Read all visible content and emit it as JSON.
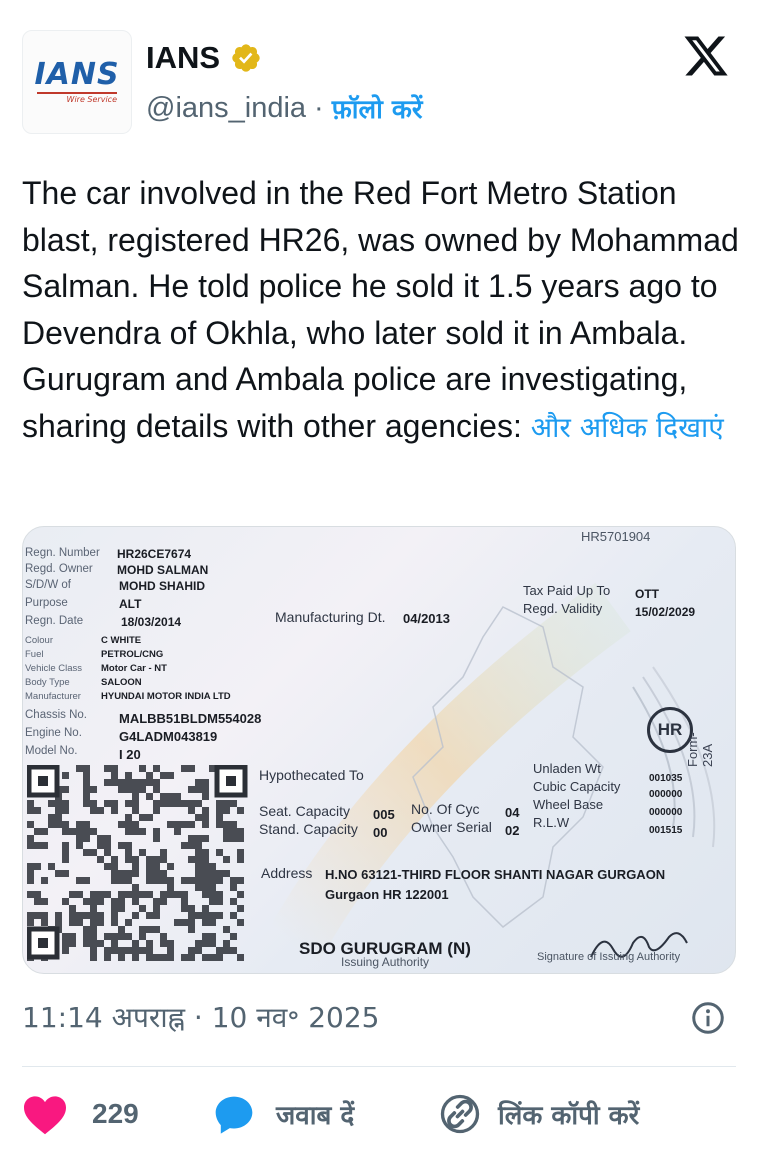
{
  "account": {
    "avatar_text": "IANS",
    "avatar_sub": "Wire Service",
    "display_name": "IANS",
    "handle": "@ians_india",
    "separator": "·",
    "follow_label": "फ़ॉलो करें"
  },
  "tweet": {
    "text": "The car involved in the Red Fort Metro Station blast, registered HR26, was owned by Mohammad Salman. He told police he sold it 1.5 years ago to Devendra of Okhla, who later sold it in Ambala. Gurugram and Ambala police are investigating, sharing details with other agencies: ",
    "show_more": "और अधिक दिखाएं"
  },
  "rc_card": {
    "top_code": "HR5701904",
    "fields": [
      {
        "label": "Regn. Number",
        "value": "HR26CE7674"
      },
      {
        "label": "Regd. Owner",
        "value": "MOHD SALMAN"
      },
      {
        "label": "S/D/W of",
        "value": "MOHD SHAHID"
      },
      {
        "label": "Purpose",
        "value": "ALT"
      },
      {
        "label": "Regn. Date",
        "value": "18/03/2014"
      },
      {
        "label": "Colour",
        "value": "C WHITE"
      },
      {
        "label": "Fuel",
        "value": "PETROL/CNG"
      },
      {
        "label": "Vehicle Class",
        "value": "Motor Car - NT"
      },
      {
        "label": "Body Type",
        "value": "SALOON"
      },
      {
        "label": "Manufacturer",
        "value": "HYUNDAI MOTOR INDIA LTD"
      },
      {
        "label": "Chassis No.",
        "value": "MALBB51BLDM554028"
      },
      {
        "label": "Engine No.",
        "value": "G4LADM043819"
      },
      {
        "label": "Model No.",
        "value": "I 20"
      }
    ],
    "mfg_label": "Manufacturing Dt.",
    "mfg_value": "04/2013",
    "tax_label": "Tax Paid Up To",
    "tax_value": "OTT",
    "validity_label": "Regd. Validity",
    "validity_value": "15/02/2029",
    "state_badge": "HR",
    "form_label": "Form-23A",
    "hypothecated_label": "Hypothecated To",
    "unladen_label": "Unladen Wt",
    "unladen_value": "001035",
    "cubic_label": "Cubic Capacity",
    "cubic_value": "000000",
    "wheelbase_label": "Wheel Base",
    "wheelbase_value": "000000",
    "rlw_label": "R.L.W",
    "rlw_value": "001515",
    "seat_label": "Seat. Capacity",
    "seat_value": "005",
    "stand_label": "Stand. Capacity",
    "stand_value": "00",
    "cyc_label": "No. Of Cyc",
    "cyc_value": "04",
    "owner_serial_label": "Owner Serial",
    "owner_serial_value": "02",
    "address_label": "Address",
    "address_line1": "H.NO 63121-THIRD FLOOR SHANTI NAGAR GURGAON",
    "address_line2": "Gurgaon HR 122001",
    "authority": "SDO GURUGRAM (N)",
    "authority_sub": "Issuing Authority",
    "signature_label": "Signature of Issuing Authority"
  },
  "meta": {
    "time": "11:14 अपराह्न",
    "separator": "·",
    "date": "10 नव॰ 2025"
  },
  "actions": {
    "like_count": "229",
    "reply_label": "जवाब दें",
    "copy_link_label": "लिंक कॉपी करें"
  },
  "colors": {
    "accent": "#1d9bf0",
    "like": "#f91880",
    "text": "#0f1419",
    "muted": "#536471",
    "verified_gold": "#e2b719"
  },
  "icons": [
    "verified-badge-icon",
    "x-logo-icon",
    "info-icon",
    "heart-icon",
    "reply-icon",
    "link-icon"
  ]
}
